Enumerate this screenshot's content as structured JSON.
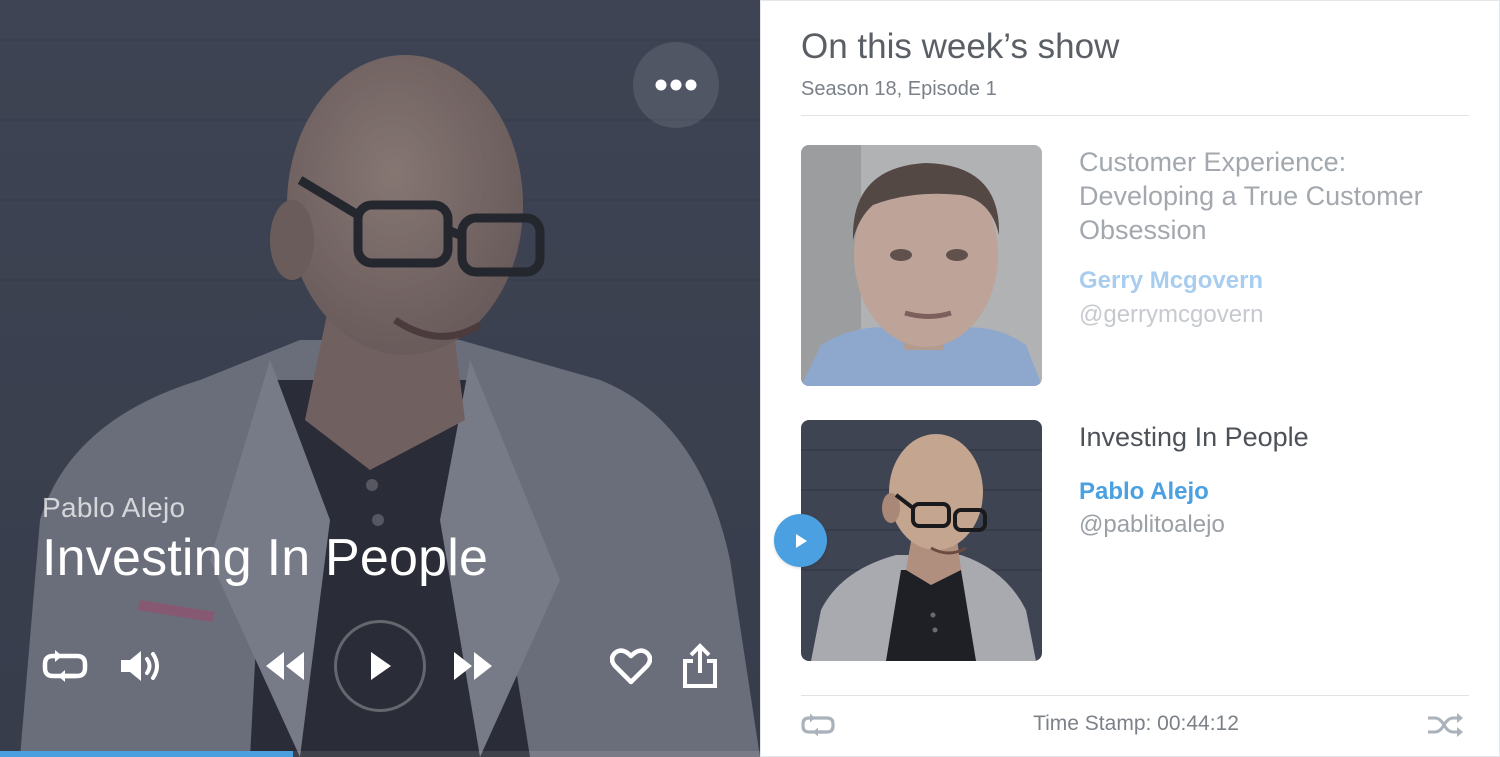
{
  "now_playing": {
    "artist": "Pablo Alejo",
    "title": "Investing In People",
    "progress": 0.385
  },
  "player_controls": {
    "icons": [
      "more-icon",
      "repeat-icon",
      "volume-icon",
      "rewind-icon",
      "play-icon",
      "fast-forward-icon",
      "heart-icon",
      "share-icon"
    ]
  },
  "show": {
    "heading": "On this week’s show",
    "season_episode": "Season 18, Episode 1"
  },
  "episodes": [
    {
      "title": "Customer Experience: Developing a True Customer Obsession",
      "guest": "Gerry Mcgovern",
      "handle": "@gerrymcgovern",
      "state": "upcoming"
    },
    {
      "title": "Investing In People",
      "guest": "Pablo Alejo",
      "handle": "@pablitoalejo",
      "state": "playing"
    }
  ],
  "footer": {
    "timestamp": "Time Stamp: 00:44:12"
  },
  "colors": {
    "accent": "#4aa0e1",
    "player_bg": "#3d4352",
    "muted_text": "#7a8088"
  }
}
